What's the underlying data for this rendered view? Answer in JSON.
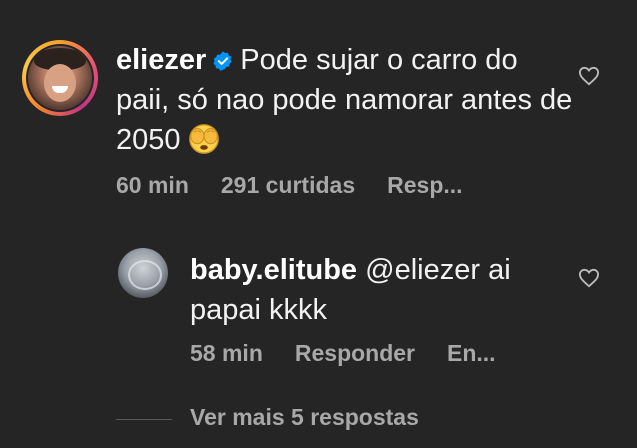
{
  "comment": {
    "username": "eliezer",
    "text": "Pode sujar o carro do paii, só nao pode namorar antes de 2050",
    "meta": {
      "time": "60 min",
      "likes": "291 curtidas",
      "reply": "Resp..."
    },
    "verified_color": "#0095f6"
  },
  "reply": {
    "username": "baby.elitube",
    "mention": "@eliezer",
    "text": "ai papai kkkk",
    "meta": {
      "time": "58 min",
      "reply": "Responder",
      "send": "En..."
    }
  },
  "view_more": "Ver mais 5 respostas",
  "icons": {
    "emoji": "see-no-evil-face-emoji",
    "like": "heart-outline-icon",
    "verified": "verified-badge-icon"
  }
}
